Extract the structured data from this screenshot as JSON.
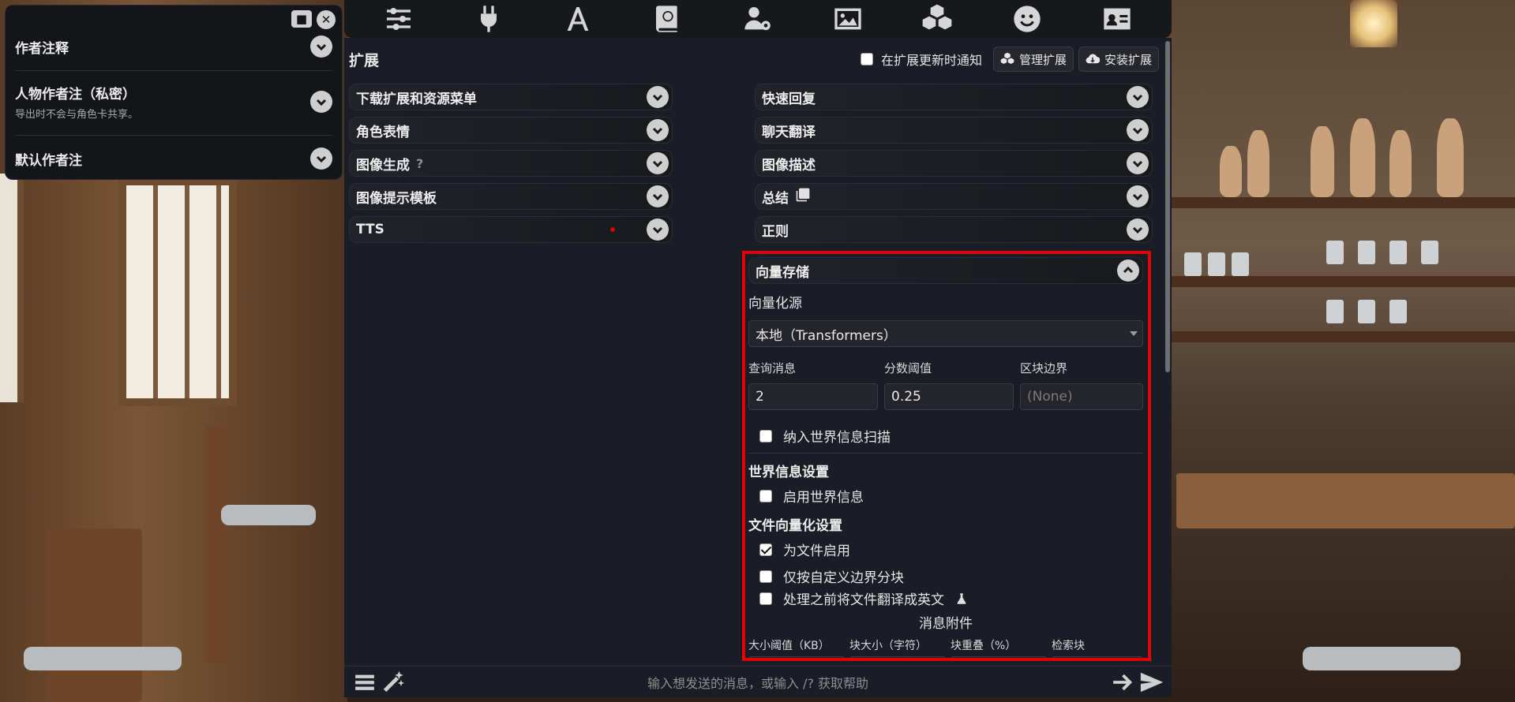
{
  "top_icons": [
    "sliders-icon",
    "plug-icon",
    "font-icon",
    "book-globe-icon",
    "user-gear-icon",
    "image-icon",
    "cubes-icon",
    "smile-icon",
    "id-card-icon"
  ],
  "author_panel": {
    "items": [
      {
        "title": "作者注释",
        "subtitle": ""
      },
      {
        "title": "人物作者注（私密）",
        "subtitle": "导出时不会与角色卡共享。"
      },
      {
        "title": "默认作者注",
        "subtitle": ""
      }
    ]
  },
  "extensions": {
    "title": "扩展",
    "notify_label": "在扩展更新时通知",
    "manage_label": "管理扩展",
    "install_label": "安装扩展",
    "left_column": [
      {
        "label": "下载扩展和资源菜单"
      },
      {
        "label": "角色表情"
      },
      {
        "label": "图像生成",
        "hint": "?"
      },
      {
        "label": "图像提示模板"
      },
      {
        "label": "TTS"
      }
    ],
    "right_column": [
      {
        "label": "快速回复"
      },
      {
        "label": "聊天翻译"
      },
      {
        "label": "图像描述"
      },
      {
        "label": "总结"
      },
      {
        "label": "正则"
      }
    ]
  },
  "vector_storage": {
    "title": "向量存储",
    "source_label": "向量化源",
    "source_value": "本地（Transformers）",
    "query_label": "查询消息",
    "query_value": "2",
    "score_label": "分数阈值",
    "score_value": "0.25",
    "chunk_label": "区块边界",
    "chunk_placeholder": "(None)",
    "include_wi_label": "纳入世界信息扫描",
    "wi_section": "世界信息设置",
    "enable_wi_label": "启用世界信息",
    "file_section": "文件向量化设置",
    "enable_files_label": "为文件启用",
    "custom_boundary_label": "仅按自定义边界分块",
    "translate_label": "处理之前将文件翻译成英文",
    "attachments_label": "消息附件",
    "size_threshold_label": "大小阈值（KB）",
    "chunk_size_label": "块大小（字符）",
    "chunk_overlap_label": "块重叠（%）",
    "retrieve_chunks_label": "检索块",
    "enable_files_checked": true
  },
  "bottom_bar": {
    "placeholder": "输入想发送的消息，或输入 /? 获取帮助"
  }
}
